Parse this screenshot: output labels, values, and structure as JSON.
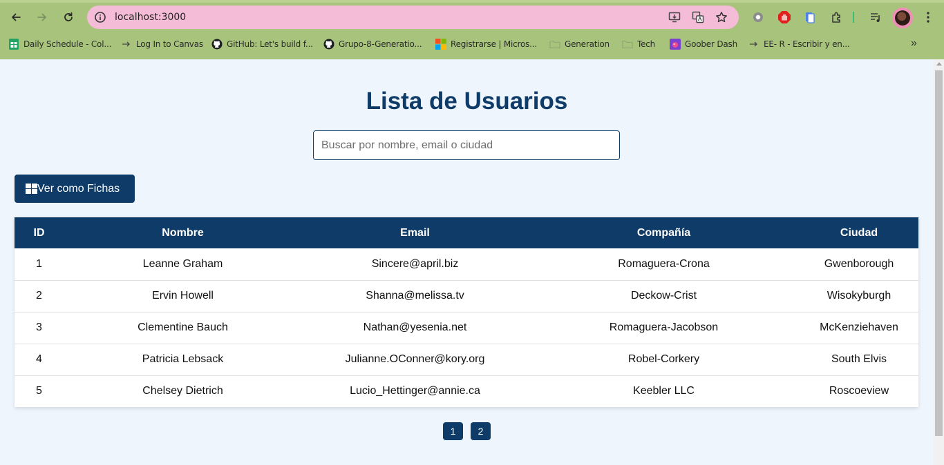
{
  "browser": {
    "url": "localhost:3000",
    "accent_color": "#a8c47c",
    "omnibox_color": "#f4bcd6",
    "bookmarks": [
      {
        "label": "Daily Schedule - Col...",
        "icon": "sheets-icon"
      },
      {
        "label": "Log In to Canvas",
        "icon": "arrow-icon"
      },
      {
        "label": "GitHub: Let's build f...",
        "icon": "github-icon"
      },
      {
        "label": "Grupo-8-Generatio...",
        "icon": "github-icon"
      },
      {
        "label": "Registrarse | Micros...",
        "icon": "microsoft-icon"
      },
      {
        "label": "Generation",
        "icon": "folder-icon"
      },
      {
        "label": "Tech",
        "icon": "folder-icon"
      },
      {
        "label": "Goober Dash",
        "icon": "game-icon"
      },
      {
        "label": "EE- R - Escribir y en...",
        "icon": "arrow-icon"
      }
    ],
    "more_bookmarks": "»"
  },
  "page": {
    "title": "Lista de Usuarios",
    "search_placeholder": "Buscar por nombre, email o ciudad",
    "search_value": "",
    "view_button_label": "Ver como Fichas",
    "primary_color": "#0f3b68",
    "table": {
      "headers": [
        "ID",
        "Nombre",
        "Email",
        "Compañía",
        "Ciudad"
      ],
      "rows": [
        [
          "1",
          "Leanne Graham",
          "Sincere@april.biz",
          "Romaguera-Crona",
          "Gwenborough"
        ],
        [
          "2",
          "Ervin Howell",
          "Shanna@melissa.tv",
          "Deckow-Crist",
          "Wisokyburgh"
        ],
        [
          "3",
          "Clementine Bauch",
          "Nathan@yesenia.net",
          "Romaguera-Jacobson",
          "McKenziehaven"
        ],
        [
          "4",
          "Patricia Lebsack",
          "Julianne.OConner@kory.org",
          "Robel-Corkery",
          "South Elvis"
        ],
        [
          "5",
          "Chelsey Dietrich",
          "Lucio_Hettinger@annie.ca",
          "Keebler LLC",
          "Roscoeview"
        ]
      ]
    },
    "pagination": [
      "1",
      "2"
    ]
  }
}
